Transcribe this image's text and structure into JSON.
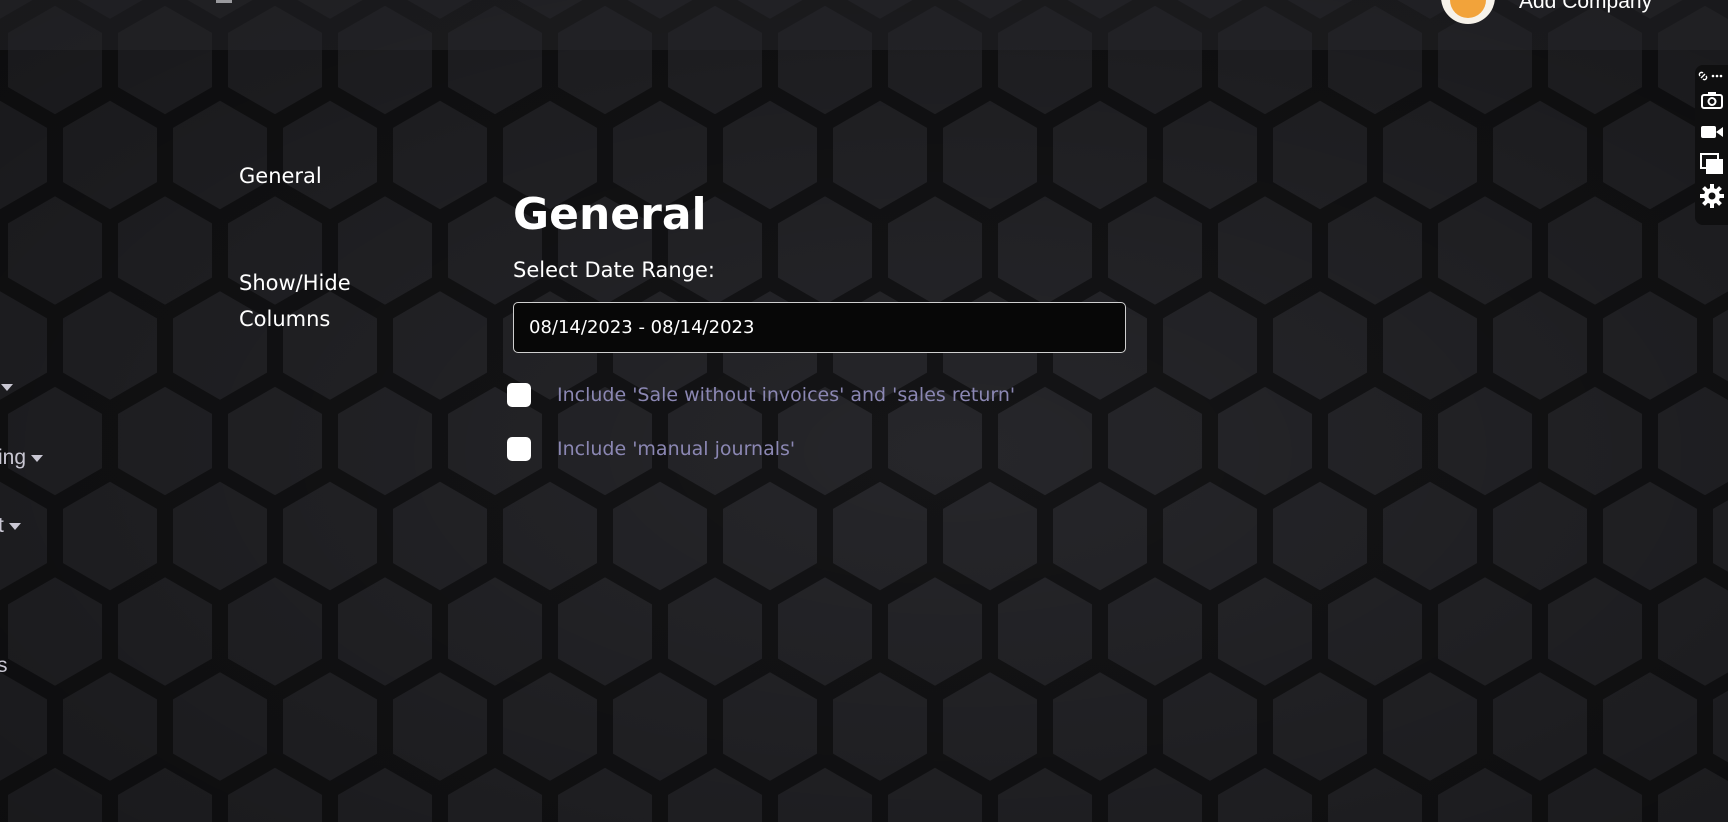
{
  "header": {
    "add_company_label": "Add Company"
  },
  "left_nav_fragments": {
    "item1": "",
    "item2": "ing",
    "item3": "t",
    "item4": "s"
  },
  "side_nav": {
    "items": [
      {
        "label": "General"
      },
      {
        "label": "Show/Hide Columns"
      }
    ]
  },
  "main": {
    "title": "General",
    "date_range_label": "Select Date Range:",
    "date_range_value": "08/14/2023 - 08/14/2023",
    "checkboxes": [
      {
        "label": "Include 'Sale without invoices' and 'sales return'",
        "checked": false
      },
      {
        "label": "Include 'manual journals'",
        "checked": false
      }
    ]
  },
  "toolbar": {
    "icons": [
      "link-icon",
      "more-icon",
      "camera-icon",
      "video-icon",
      "window-icon",
      "gear-icon"
    ]
  },
  "colors": {
    "background": "#1d1d1f",
    "checkbox_label": "#8b87b3",
    "avatar_accent": "#f2a33a"
  }
}
